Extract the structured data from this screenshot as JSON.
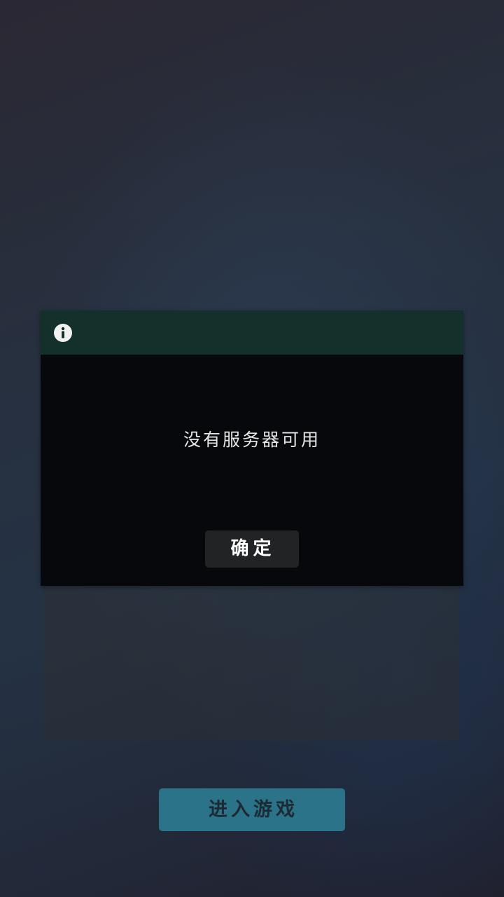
{
  "dialog": {
    "header_icon": "info-icon",
    "message": "没有服务器可用",
    "confirm_label": "确定"
  },
  "main": {
    "enter_game_label": "进入游戏"
  },
  "colors": {
    "dialog_header": "#14302a",
    "dialog_body": "#06080b",
    "confirm_button": "#222325",
    "enter_button": "#2a7389",
    "enter_button_text": "#1c2a33"
  }
}
